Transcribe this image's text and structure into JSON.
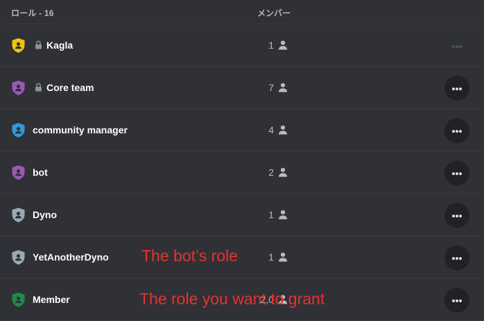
{
  "header": {
    "roles_label": "ロール - 16",
    "members_label": "メンバー"
  },
  "roles": [
    {
      "name": "Kagla",
      "count": "1",
      "color": "#f1c40f",
      "locked": true
    },
    {
      "name": "Core team",
      "count": "7",
      "color": "#9b59b6",
      "locked": true
    },
    {
      "name": "community manager",
      "count": "4",
      "color": "#3498db",
      "locked": false
    },
    {
      "name": "bot",
      "count": "2",
      "color": "#9b59b6",
      "locked": false
    },
    {
      "name": "Dyno",
      "count": "1",
      "color": "#99aab5",
      "locked": false
    },
    {
      "name": "YetAnotherDyno",
      "count": "1",
      "color": "#99aab5",
      "locked": false
    },
    {
      "name": "Member",
      "count": "2,0",
      "color": "#1f8b4c",
      "locked": false
    }
  ],
  "annotations": {
    "bot_role": "The bot’s role",
    "grant_role": "The role you want to grant"
  },
  "icons": {
    "role_badge": "shield-user-icon",
    "lock": "lock-icon",
    "members": "person-icon",
    "more": "more-horizontal-icon"
  }
}
